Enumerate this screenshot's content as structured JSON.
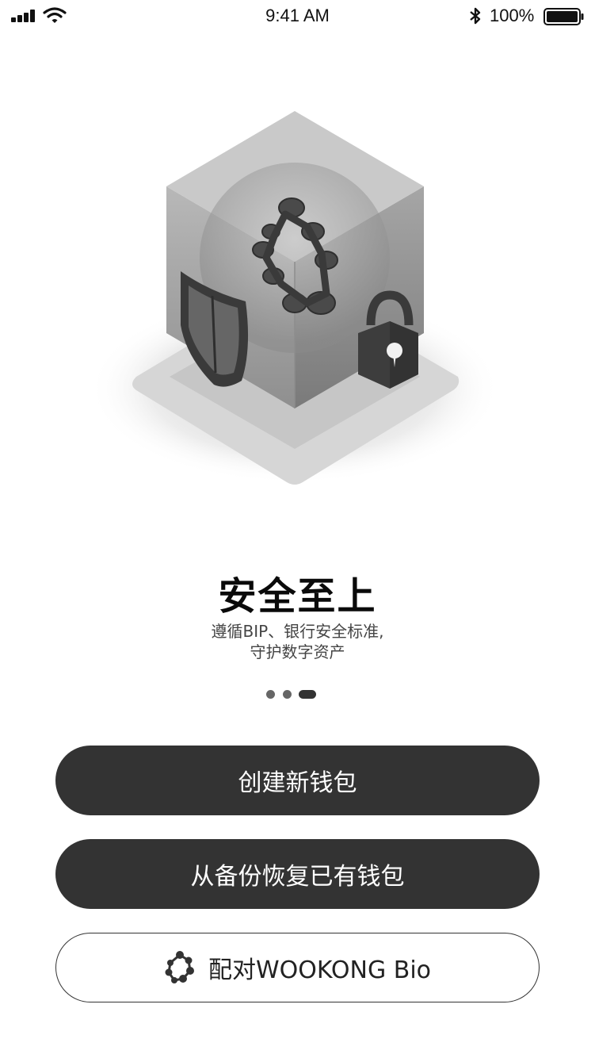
{
  "status_bar": {
    "time": "9:41 AM",
    "battery_percent": "100%",
    "battery_level": 1.0
  },
  "onboarding": {
    "title": "安全至上",
    "subtitle_line1": "遵循BIP、银行安全标准,",
    "subtitle_line2": "守护数字资产",
    "page_index": 3,
    "page_count": 3
  },
  "buttons": {
    "create_wallet": "创建新钱包",
    "restore_wallet": "从备份恢复已有钱包",
    "pair_device": "配对WOOKONG Bio"
  },
  "colors": {
    "button_dark": "#333333",
    "text_primary": "#0a0a0a",
    "text_secondary": "#444444"
  }
}
